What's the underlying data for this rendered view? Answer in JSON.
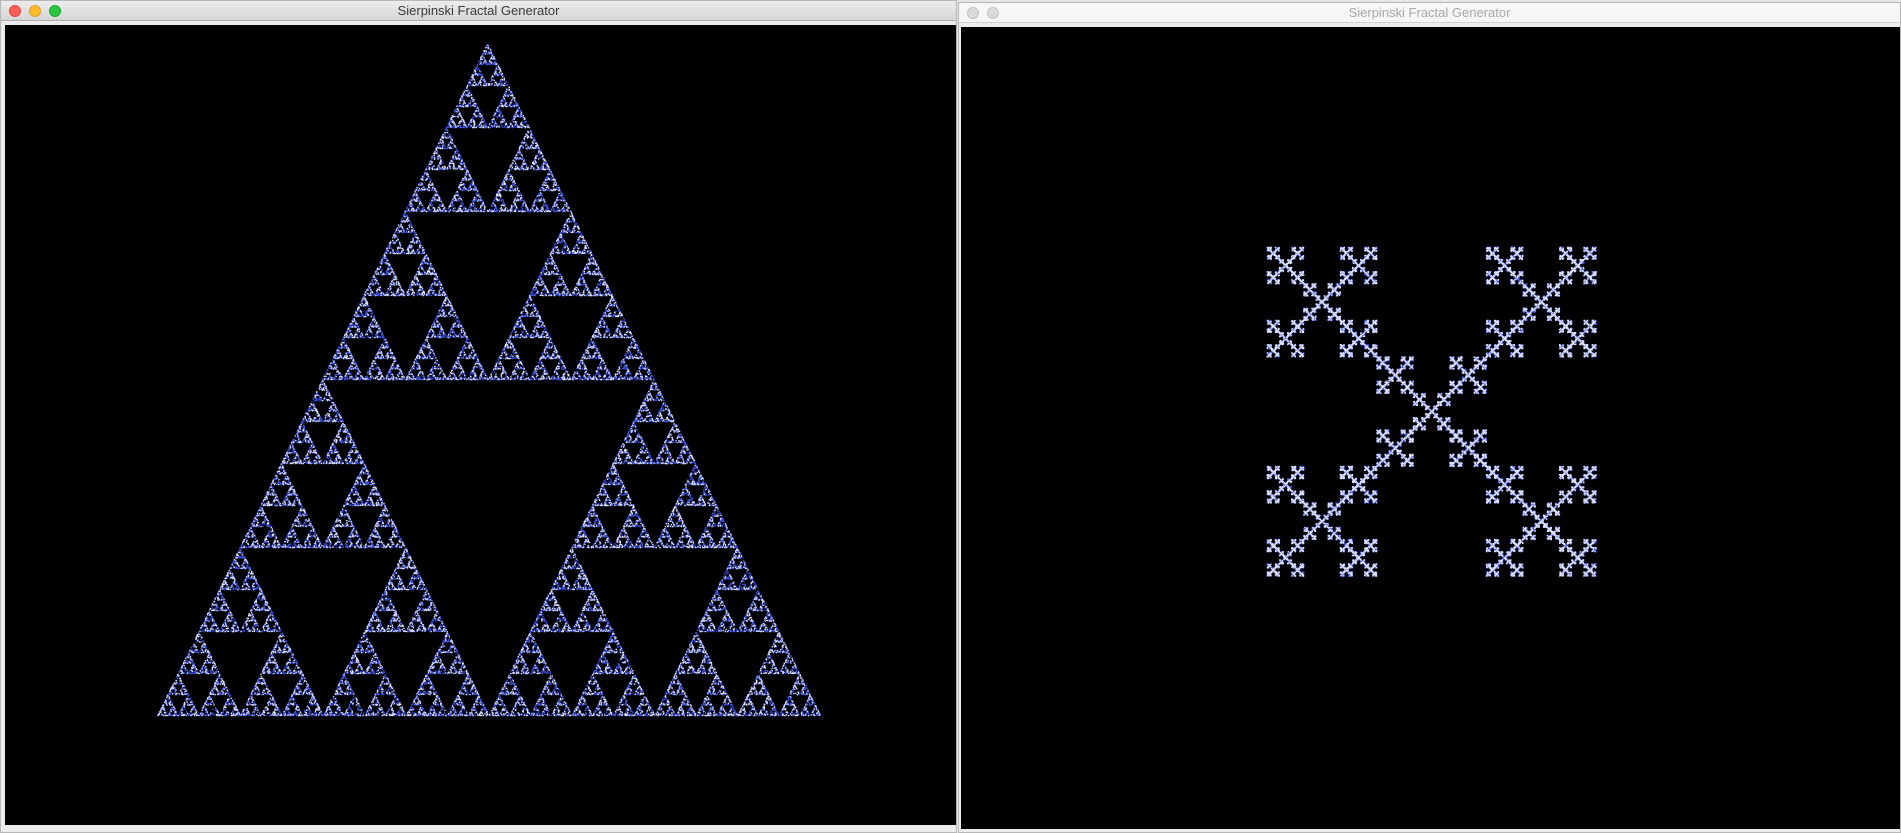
{
  "windows": [
    {
      "title": "Sierpinski Fractal Generator",
      "active": true,
      "fractal": "sierpinski-triangle",
      "controls": {
        "close": "close-icon",
        "minimize": "minimize-icon",
        "zoom": "zoom-icon"
      }
    },
    {
      "title": "Sierpinski Fractal Generator",
      "active": false,
      "fractal": "vicsek-cross-fractal",
      "controls": {
        "close": "close-icon",
        "minimize": "minimize-icon"
      }
    }
  ],
  "colors": {
    "canvas_bg": "#000000",
    "point_primary": "#3b4fd8",
    "point_secondary": "#dfe3ff"
  }
}
